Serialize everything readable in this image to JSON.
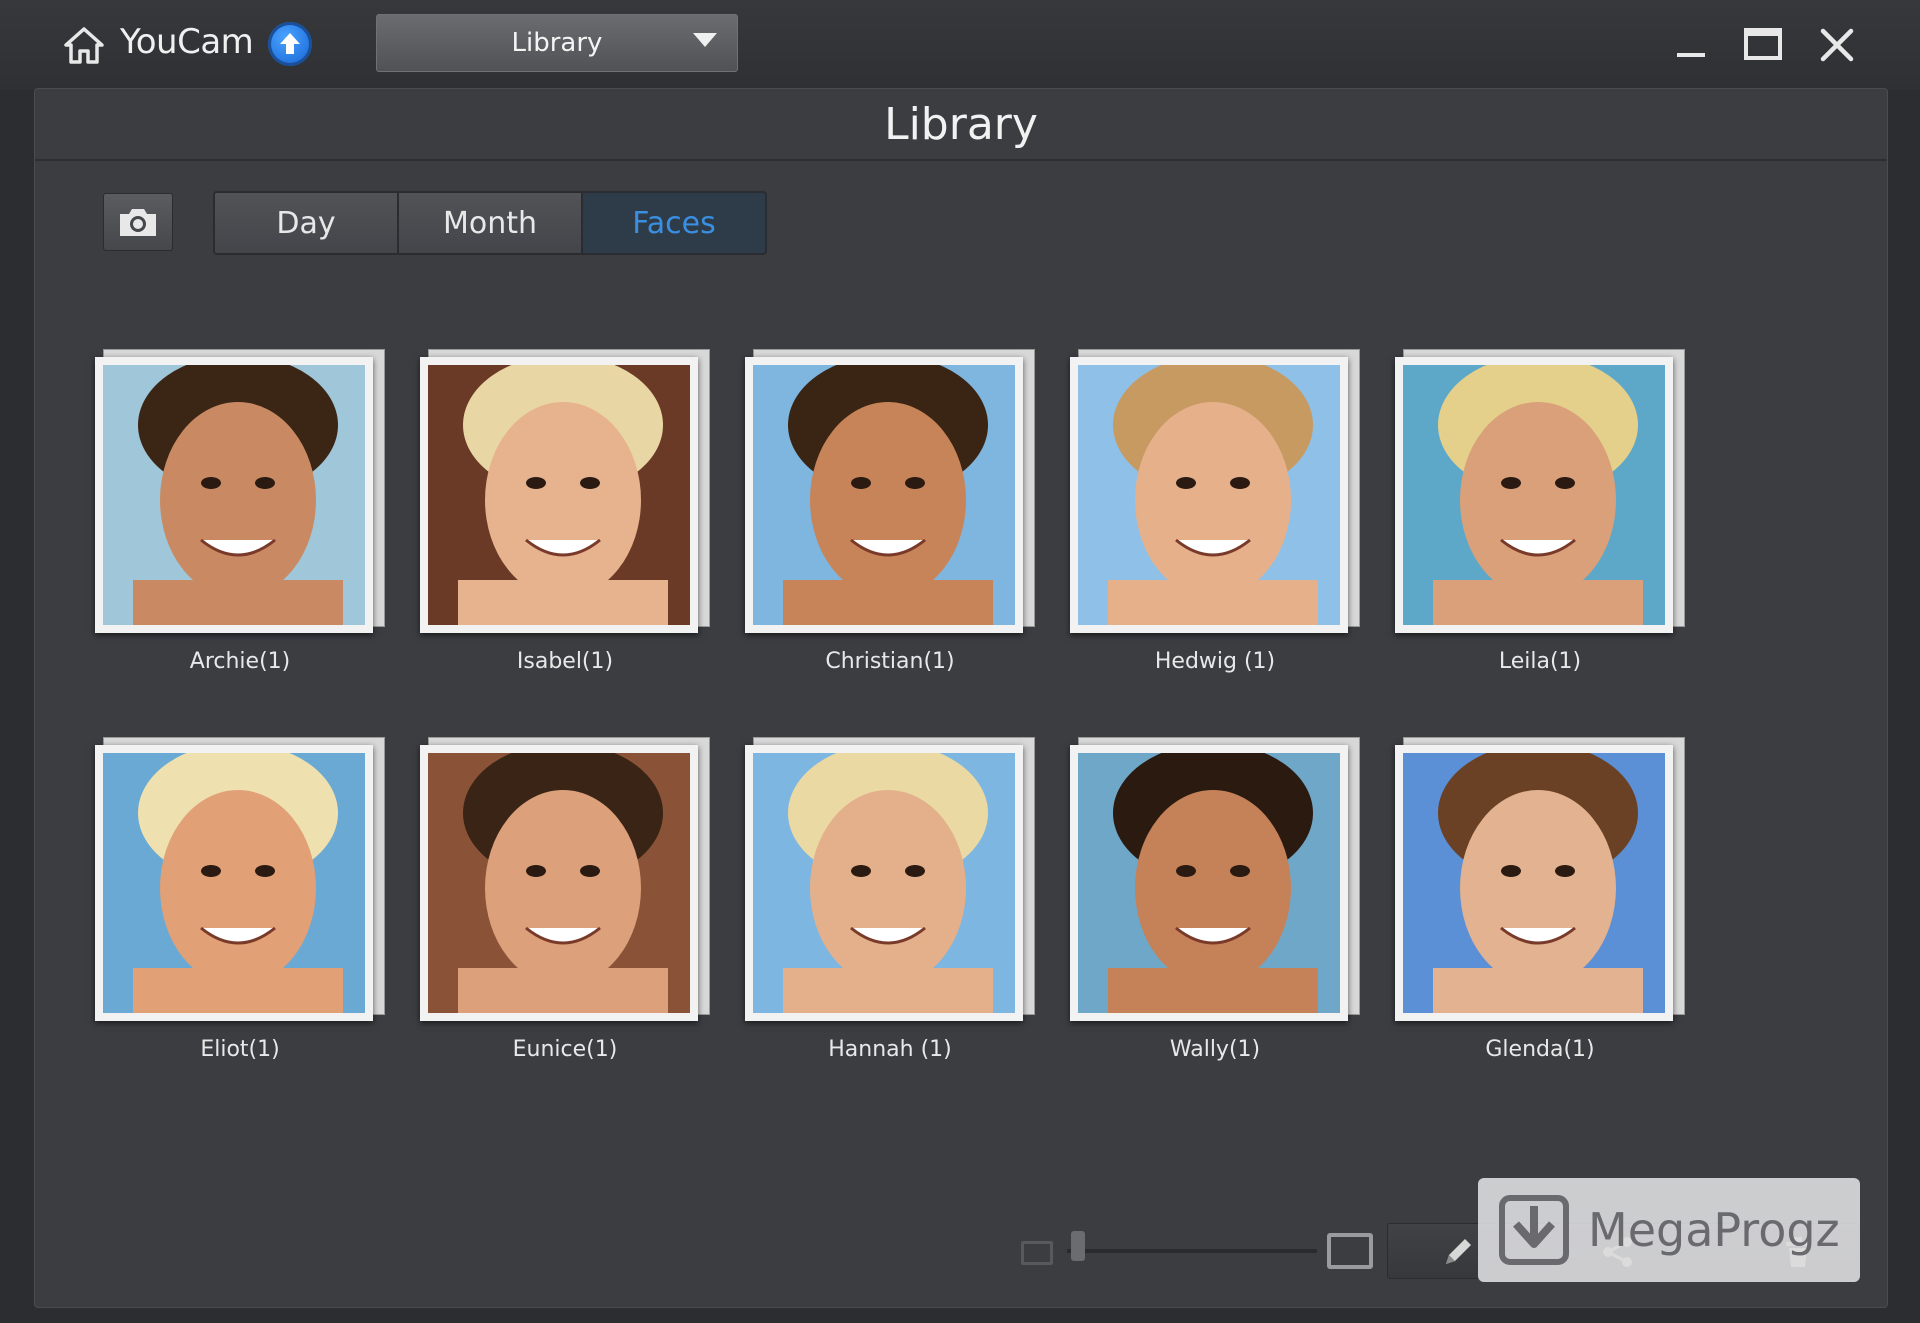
{
  "titlebar": {
    "app_name": "YouCam",
    "view_selector": "Library",
    "icons": [
      "home-icon",
      "update-icon",
      "minimize-icon",
      "maximize-icon",
      "close-icon"
    ]
  },
  "panel": {
    "title": "Library",
    "tabs": [
      {
        "label": "Day",
        "active": false
      },
      {
        "label": "Month",
        "active": false
      },
      {
        "label": "Faces",
        "active": true
      }
    ]
  },
  "faces": [
    {
      "name": "Archie(1)",
      "skin": "#c98a63",
      "hair": "#3b2515",
      "bg": "#9fc6d9"
    },
    {
      "name": "Isabel(1)",
      "skin": "#e7b38f",
      "hair": "#e9d6a5",
      "bg": "#6b3a26"
    },
    {
      "name": "Christian(1)",
      "skin": "#c78458",
      "hair": "#3a2413",
      "bg": "#7fb6e0"
    },
    {
      "name": "Hedwig (1)",
      "skin": "#e5b08a",
      "hair": "#c79a62",
      "bg": "#8fc0e8"
    },
    {
      "name": "Leila(1)",
      "skin": "#d9a07a",
      "hair": "#e4d08a",
      "bg": "#5da7c9"
    },
    {
      "name": "Eliot(1)",
      "skin": "#e2a077",
      "hair": "#efe0b0",
      "bg": "#69a9d4"
    },
    {
      "name": "Eunice(1)",
      "skin": "#dca07b",
      "hair": "#3a2416",
      "bg": "#8a5236"
    },
    {
      "name": "Hannah (1)",
      "skin": "#e3b08b",
      "hair": "#ebd9a3",
      "bg": "#7db6e0"
    },
    {
      "name": "Wally(1)",
      "skin": "#c58259",
      "hair": "#2b1a10",
      "bg": "#6fa7c8"
    },
    {
      "name": "Glenda(1)",
      "skin": "#e2b291",
      "hair": "#6a4124",
      "bg": "#5b8fd6"
    }
  ],
  "bottom": {
    "tool_icons": [
      "zoom-small-icon",
      "zoom-large-icon",
      "edit-icon",
      "share-icon",
      "delete-icon"
    ]
  },
  "watermark": {
    "text": "MegaProgz"
  }
}
